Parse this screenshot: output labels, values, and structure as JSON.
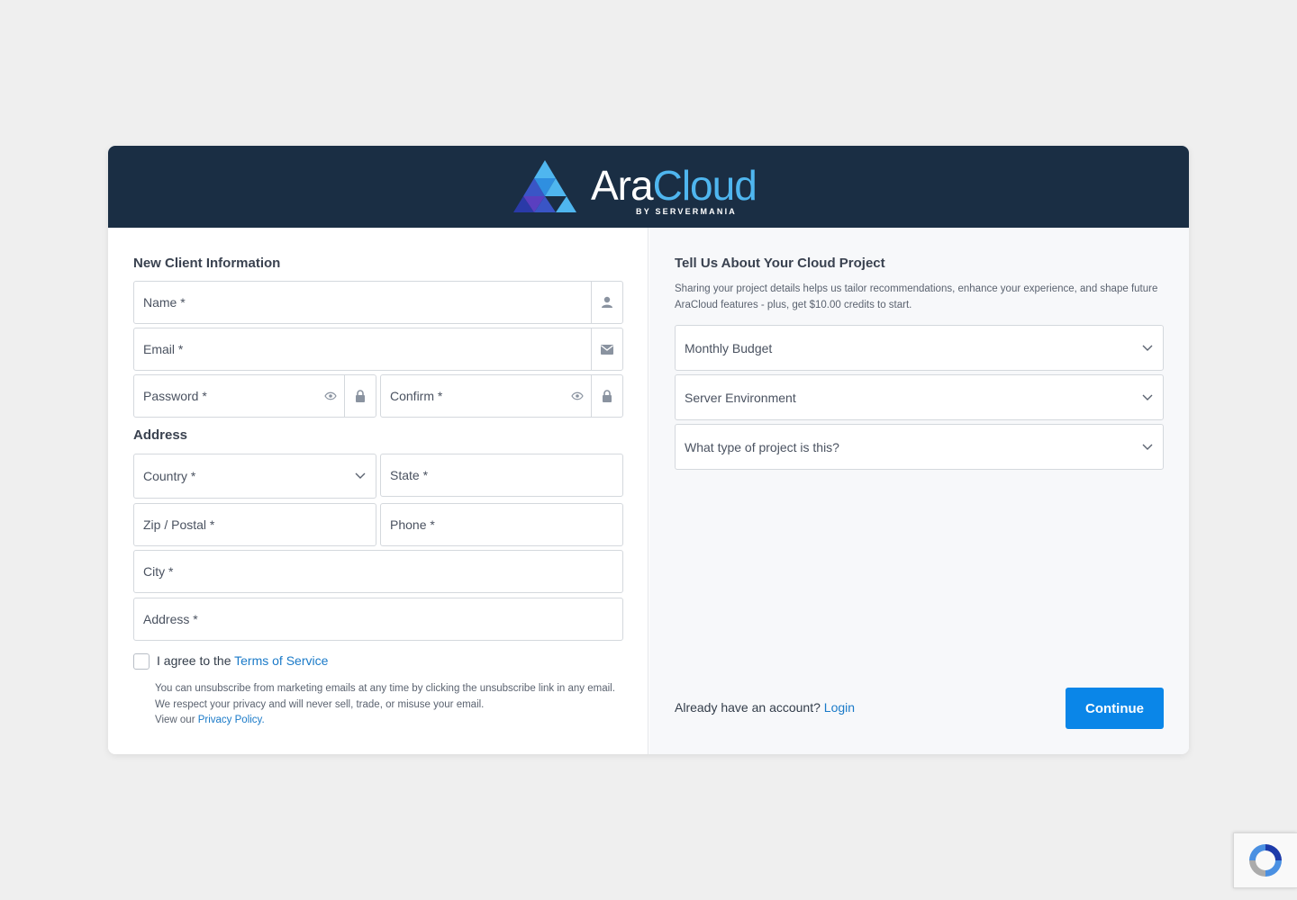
{
  "brand": {
    "name_part1": "Ara",
    "name_part2": "Cloud",
    "tagline": "BY SERVERMANIA"
  },
  "left": {
    "title": "New Client Information",
    "name_label": "Name *",
    "email_label": "Email *",
    "password_label": "Password *",
    "confirm_label": "Confirm *",
    "address_title": "Address",
    "country_label": "Country *",
    "state_label": "State *",
    "zip_label": "Zip / Postal *",
    "phone_label": "Phone *",
    "city_label": "City *",
    "address_label": "Address *",
    "agree_prefix": "I agree to the ",
    "agree_link": "Terms of Service",
    "fine_print": "You can unsubscribe from marketing emails at any time by clicking the unsubscribe link in any email. We respect your privacy and will never sell, trade, or misuse your email.",
    "fine_print_prefix": "View our ",
    "privacy_link": "Privacy Policy."
  },
  "right": {
    "title": "Tell Us About Your Cloud Project",
    "description": "Sharing your project details helps us tailor recommendations, enhance your experience, and shape future AraCloud features - plus, get $10.00 credits to start.",
    "selects": [
      "Monthly Budget",
      "Server Environment",
      "What type of project is this?"
    ],
    "already_text": "Already have an account? ",
    "login_link": "Login",
    "continue_label": "Continue"
  },
  "colors": {
    "header_bg": "#1a2e44",
    "accent": "#0a86e8",
    "link": "#1a7ac8"
  },
  "icons": [
    "user-icon",
    "envelope-icon",
    "eye-icon",
    "lock-icon",
    "chevron-down-icon",
    "recaptcha-icon"
  ]
}
